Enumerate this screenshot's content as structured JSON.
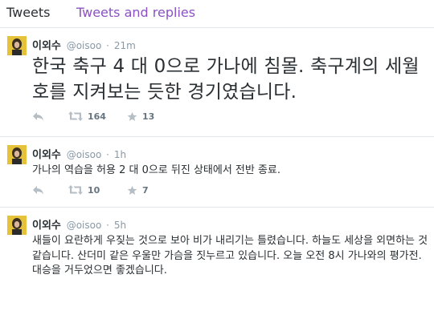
{
  "tabs": {
    "tweets": "Tweets",
    "tweets_and_replies": "Tweets and replies"
  },
  "colors": {
    "tab_accent": "#8a52c2",
    "muted": "#8899a6",
    "text": "#292f33",
    "avatar_bg": "#e6c23a"
  },
  "tweets": [
    {
      "name": "이외수",
      "handle": "@oisoo",
      "separator": "·",
      "time": "21m",
      "text": "한국 축구 4 대 0으로 가나에 침몰. 축구계의 세월호를 지켜보는 듯한 경기였습니다.",
      "retweets": "164",
      "favorites": "13"
    },
    {
      "name": "이외수",
      "handle": "@oisoo",
      "separator": "·",
      "time": "1h",
      "text": "가나의 역습을 허용 2 대 0으로 뒤진 상태에서 전반 종료.",
      "retweets": "10",
      "favorites": "7"
    },
    {
      "name": "이외수",
      "handle": "@oisoo",
      "separator": "·",
      "time": "5h",
      "text": "새들이 요란하게 우짖는 것으로 보아 비가 내리기는 틀렸습니다. 하늘도 세상을 외면하는 것 같습니다. 산더미 같은 우울만 가슴을 짓누르고 있습니다. 오늘 오전 8시 가나와의 평가전. 대승을 거두었으면 좋겠습니다.",
      "retweets": "",
      "favorites": ""
    }
  ],
  "icons": {
    "reply": "reply-icon",
    "retweet": "retweet-icon",
    "favorite": "star-icon",
    "avatar": "avatar-portrait"
  }
}
